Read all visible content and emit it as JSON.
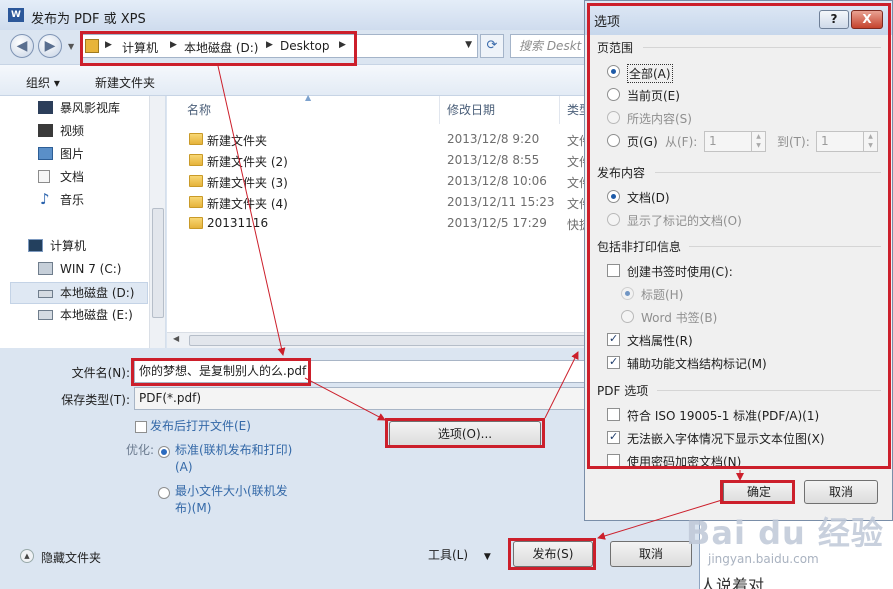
{
  "main": {
    "title": "发布为 PDF 或 XPS",
    "title_icon": "W",
    "breadcrumbs": [
      "计算机",
      "本地磁盘 (D:)",
      "Desktop"
    ],
    "search_placeholder": "搜索 Deskt",
    "toolbar": {
      "organize": "组织 ▾",
      "new_folder": "新建文件夹"
    },
    "nav": [
      {
        "label": "暴风影视库",
        "icon": "video-library-icon"
      },
      {
        "label": "视频",
        "icon": "video-icon"
      },
      {
        "label": "图片",
        "icon": "picture-icon"
      },
      {
        "label": "文档",
        "icon": "document-icon"
      },
      {
        "label": "音乐",
        "icon": "music-icon"
      },
      {
        "label": "计算机",
        "icon": "computer-icon"
      },
      {
        "label": "WIN 7 (C:)",
        "icon": "system-drive-icon"
      },
      {
        "label": "本地磁盘 (D:)",
        "icon": "drive-icon"
      },
      {
        "label": "本地磁盘 (E:)",
        "icon": "drive-icon"
      }
    ],
    "columns": {
      "name": "名称",
      "date": "修改日期",
      "type": "类型"
    },
    "files": [
      {
        "name": "新建文件夹",
        "date": "2013/12/8 9:20",
        "type": "文件"
      },
      {
        "name": "新建文件夹 (2)",
        "date": "2013/12/8 8:55",
        "type": "文件"
      },
      {
        "name": "新建文件夹 (3)",
        "date": "2013/12/8 10:06",
        "type": "文件"
      },
      {
        "name": "新建文件夹 (4)",
        "date": "2013/12/11 15:23",
        "type": "文件"
      },
      {
        "name": "20131116",
        "date": "2013/12/5 17:29",
        "type": "快捷"
      }
    ],
    "filename_label": "文件名(N):",
    "filename_value": "你的梦想、是复制别人的么.pdf",
    "filetype_label": "保存类型(T):",
    "filetype_value": "PDF(*.pdf)",
    "open_after": "发布后打开文件(E)",
    "optimize_label": "优化:",
    "opt_standard": "标准(联机发布和打印)(A)",
    "opt_minimum": "最小文件大小(联机发布)(M)",
    "options_button": "选项(O)...",
    "hide_folders": "隐藏文件夹",
    "tools": "工具(L)",
    "publish_button": "发布(S)",
    "cancel_button": "取消"
  },
  "options": {
    "title": "选项",
    "help": "?",
    "close": "X",
    "page_range": {
      "title": "页范围",
      "all": "全部(A)",
      "current": "当前页(E)",
      "selection": "所选内容(S)",
      "pages": "页(G)",
      "from_label": "从(F):",
      "from_value": "1",
      "to_label": "到(T):",
      "to_value": "1"
    },
    "publish_content": {
      "title": "发布内容",
      "document": "文档(D)",
      "markup": "显示了标记的文档(O)"
    },
    "non_print": {
      "title": "包括非打印信息",
      "bookmarks": "创建书签时使用(C):",
      "headings": "标题(H)",
      "word_bookmarks": "Word 书签(B)",
      "doc_props": "文档属性(R)",
      "structure_tags": "辅助功能文档结构标记(M)"
    },
    "pdf_options": {
      "title": "PDF 选项",
      "iso": "符合 ISO 19005-1 标准(PDF/A)(1)",
      "bitmap": "无法嵌入字体情况下显示文本位图(X)",
      "encrypt": "使用密码加密文档(N)"
    },
    "ok": "确定",
    "cancel": "取消"
  },
  "watermark": {
    "logo": "Bai du 经验",
    "url": "jingyan.baidu.com"
  },
  "page_text": "人说着对",
  "colors": {
    "annotation_red": "#cc1f2b",
    "dialog_blue": "#dbe5f1"
  }
}
